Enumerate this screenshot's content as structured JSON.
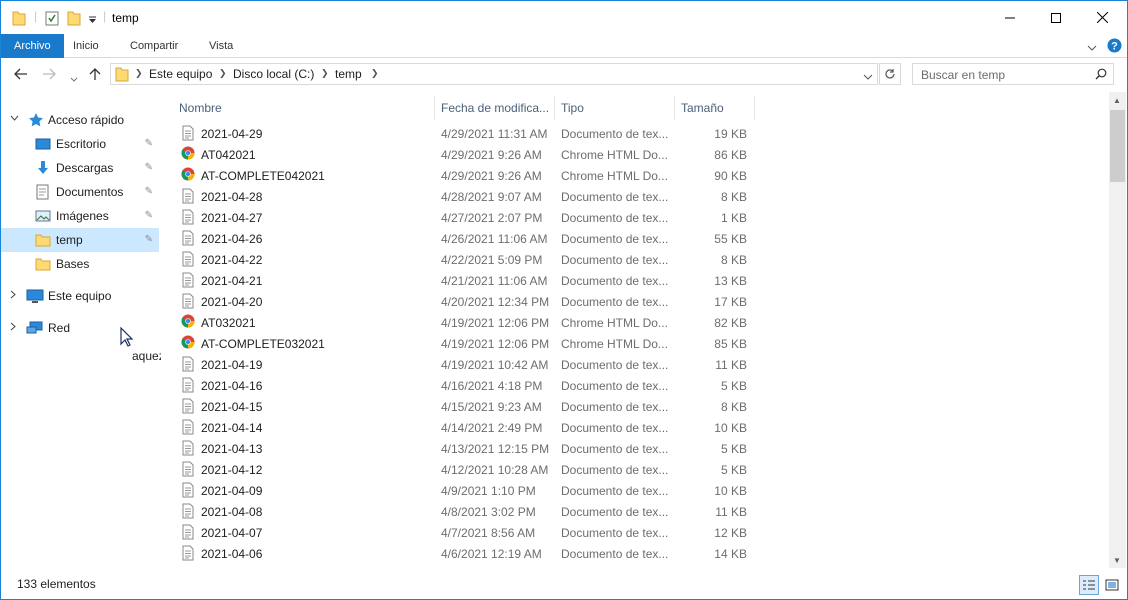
{
  "window": {
    "title": "temp"
  },
  "ribbon": {
    "tabs": [
      "Archivo",
      "Inicio",
      "Compartir",
      "Vista"
    ]
  },
  "address": {
    "crumbs": [
      "Este equipo",
      "Disco local (C:)",
      "temp"
    ]
  },
  "search": {
    "placeholder": "Buscar en temp"
  },
  "nav": {
    "quick_access": "Acceso rápido",
    "items": [
      "Escritorio",
      "Descargas",
      "Documentos",
      "Imágenes",
      "temp",
      "Bases"
    ],
    "this_pc": "Este equipo",
    "network": "Red"
  },
  "ghost_text": "aquez",
  "columns": {
    "name": "Nombre",
    "date": "Fecha de modifica...",
    "type": "Tipo",
    "size": "Tamaño"
  },
  "files": [
    {
      "name": "2021-04-29",
      "date": "4/29/2021 11:31 AM",
      "type": "Documento de tex...",
      "size": "19 KB",
      "icon": "text-document"
    },
    {
      "name": "AT042021",
      "date": "4/29/2021 9:26 AM",
      "type": "Chrome HTML Do...",
      "size": "86 KB",
      "icon": "chrome-html"
    },
    {
      "name": "AT-COMPLETE042021",
      "date": "4/29/2021 9:26 AM",
      "type": "Chrome HTML Do...",
      "size": "90 KB",
      "icon": "chrome-html"
    },
    {
      "name": "2021-04-28",
      "date": "4/28/2021 9:07 AM",
      "type": "Documento de tex...",
      "size": "8 KB",
      "icon": "text-document"
    },
    {
      "name": "2021-04-27",
      "date": "4/27/2021 2:07 PM",
      "type": "Documento de tex...",
      "size": "1 KB",
      "icon": "text-document"
    },
    {
      "name": "2021-04-26",
      "date": "4/26/2021 11:06 AM",
      "type": "Documento de tex...",
      "size": "55 KB",
      "icon": "text-document"
    },
    {
      "name": "2021-04-22",
      "date": "4/22/2021 5:09 PM",
      "type": "Documento de tex...",
      "size": "8 KB",
      "icon": "text-document"
    },
    {
      "name": "2021-04-21",
      "date": "4/21/2021 11:06 AM",
      "type": "Documento de tex...",
      "size": "13 KB",
      "icon": "text-document"
    },
    {
      "name": "2021-04-20",
      "date": "4/20/2021 12:34 PM",
      "type": "Documento de tex...",
      "size": "17 KB",
      "icon": "text-document"
    },
    {
      "name": "AT032021",
      "date": "4/19/2021 12:06 PM",
      "type": "Chrome HTML Do...",
      "size": "82 KB",
      "icon": "chrome-html"
    },
    {
      "name": "AT-COMPLETE032021",
      "date": "4/19/2021 12:06 PM",
      "type": "Chrome HTML Do...",
      "size": "85 KB",
      "icon": "chrome-html"
    },
    {
      "name": "2021-04-19",
      "date": "4/19/2021 10:42 AM",
      "type": "Documento de tex...",
      "size": "11 KB",
      "icon": "text-document"
    },
    {
      "name": "2021-04-16",
      "date": "4/16/2021 4:18 PM",
      "type": "Documento de tex...",
      "size": "5 KB",
      "icon": "text-document"
    },
    {
      "name": "2021-04-15",
      "date": "4/15/2021 9:23 AM",
      "type": "Documento de tex...",
      "size": "8 KB",
      "icon": "text-document"
    },
    {
      "name": "2021-04-14",
      "date": "4/14/2021 2:49 PM",
      "type": "Documento de tex...",
      "size": "10 KB",
      "icon": "text-document"
    },
    {
      "name": "2021-04-13",
      "date": "4/13/2021 12:15 PM",
      "type": "Documento de tex...",
      "size": "5 KB",
      "icon": "text-document"
    },
    {
      "name": "2021-04-12",
      "date": "4/12/2021 10:28 AM",
      "type": "Documento de tex...",
      "size": "5 KB",
      "icon": "text-document"
    },
    {
      "name": "2021-04-09",
      "date": "4/9/2021 1:10 PM",
      "type": "Documento de tex...",
      "size": "10 KB",
      "icon": "text-document"
    },
    {
      "name": "2021-04-08",
      "date": "4/8/2021 3:02 PM",
      "type": "Documento de tex...",
      "size": "11 KB",
      "icon": "text-document"
    },
    {
      "name": "2021-04-07",
      "date": "4/7/2021 8:56 AM",
      "type": "Documento de tex...",
      "size": "12 KB",
      "icon": "text-document"
    },
    {
      "name": "2021-04-06",
      "date": "4/6/2021 12:19 AM",
      "type": "Documento de tex...",
      "size": "14 KB",
      "icon": "text-document"
    }
  ],
  "status": {
    "count": "133 elementos"
  },
  "colors": {
    "accent": "#1979ca",
    "selection": "#cce8ff",
    "folder": "#ffd971"
  }
}
